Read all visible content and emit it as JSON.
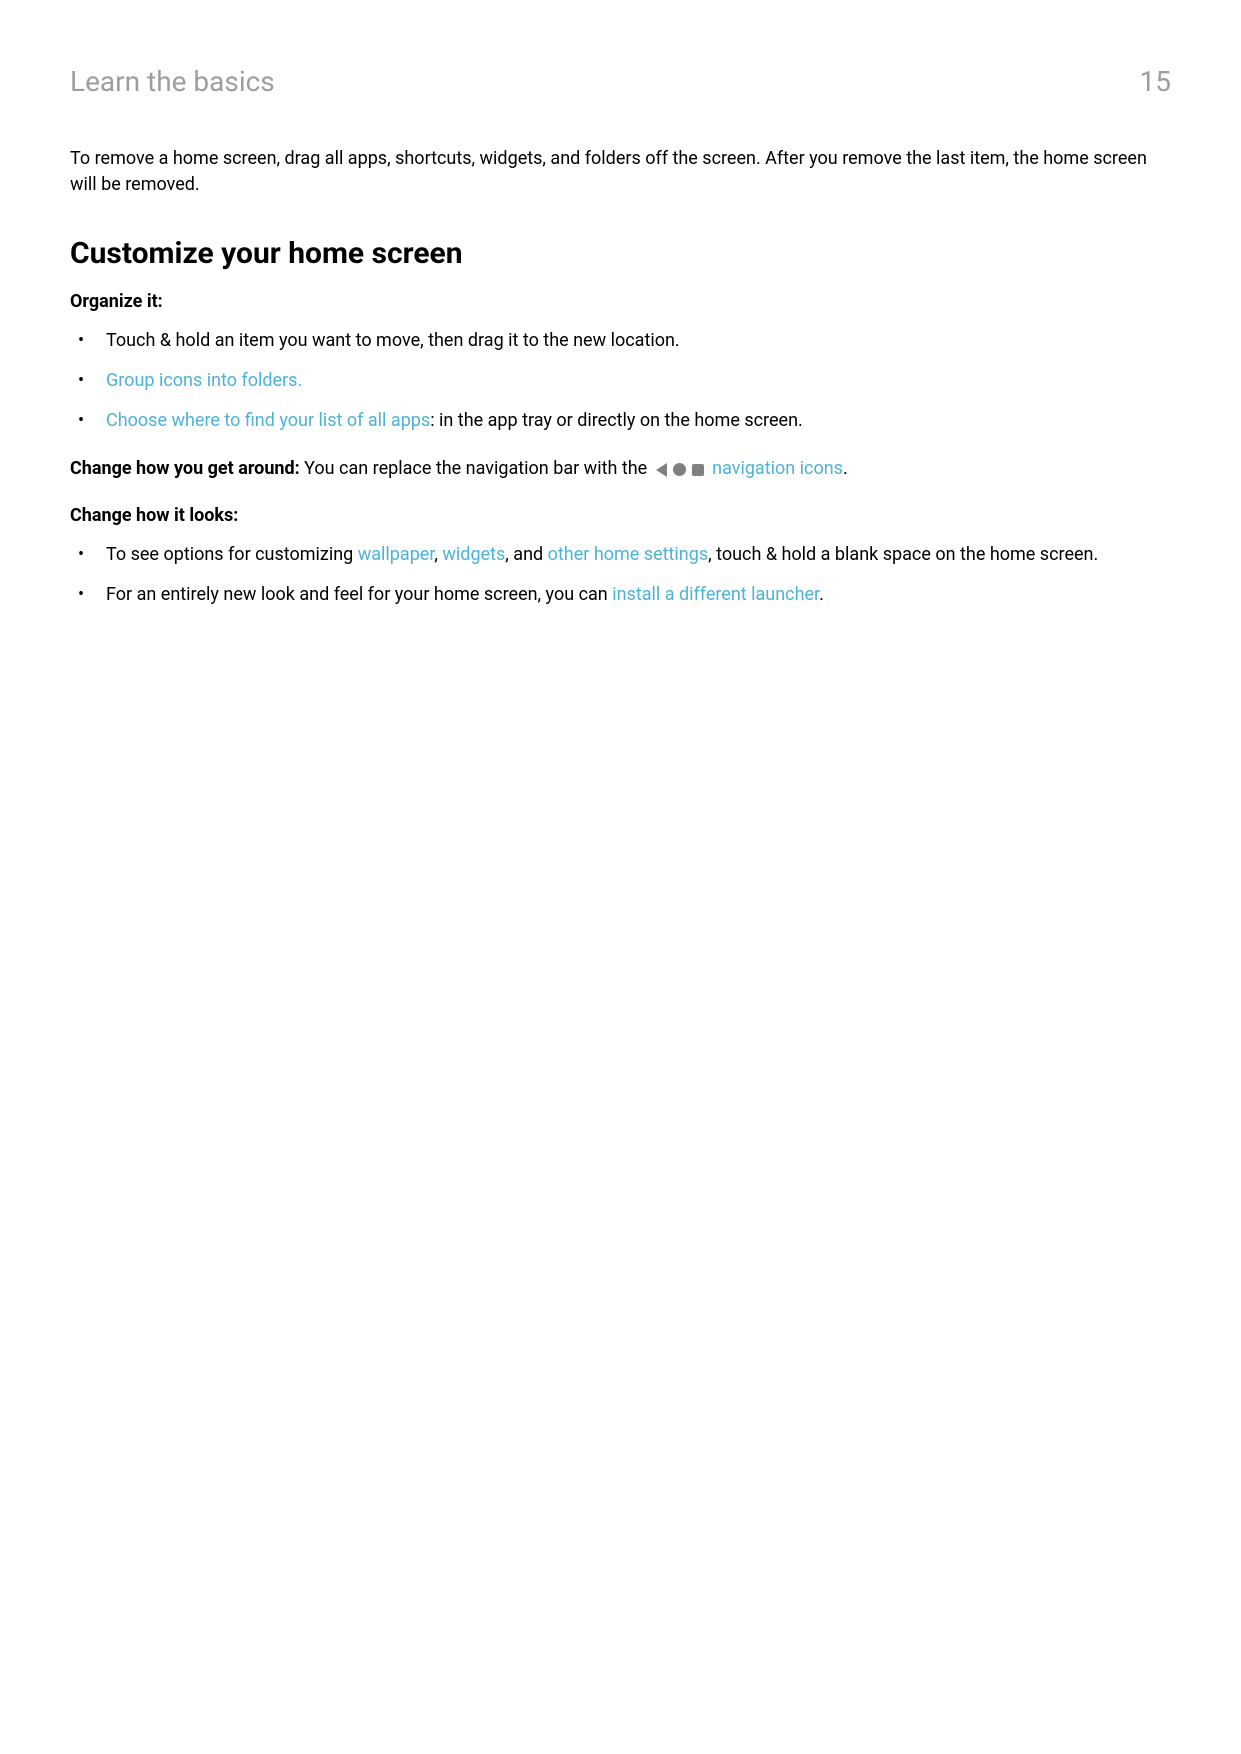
{
  "header": {
    "title": "Learn the basics",
    "pageNumber": "15"
  },
  "intro": "To remove a home screen, drag all apps, shortcuts, widgets, and folders off the screen. After you remove the last item, the home screen will be removed.",
  "sectionHeading": "Customize your home screen",
  "organize": {
    "heading": "Organize it:",
    "item1": "Touch & hold an item you want to move, then drag it to the new location.",
    "item2Link": "Group icons into folders.",
    "item3Link": "Choose where to find your list of all apps",
    "item3Rest": ": in the app tray or directly on the home screen."
  },
  "getAround": {
    "boldLabel": "Change how you get around:",
    "text1": " You can replace the navigation bar with the ",
    "linkText": "navigation icons",
    "period": "."
  },
  "looks": {
    "heading": "Change how it looks:",
    "item1_part1": "To see options for customizing ",
    "item1_link1": "wallpaper",
    "item1_comma1": ", ",
    "item1_link2": "widgets",
    "item1_comma2": ", and ",
    "item1_link3": "other home settings",
    "item1_rest": ", touch & hold a blank space on the home screen.",
    "item2_part1": "For an entirely new look and feel for your home screen, you can ",
    "item2_link": "install a different launcher",
    "item2_period": "."
  }
}
